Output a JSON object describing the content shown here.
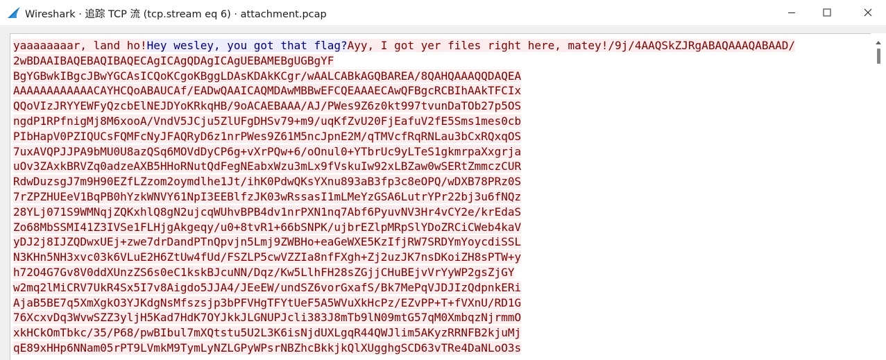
{
  "window": {
    "title": "Wireshark · 追踪 TCP 流 (tcp.stream eq 6) · attachment.pcap",
    "icon": "wireshark-fin-icon",
    "controls": [
      "minimize-icon",
      "maximize-icon",
      "close-icon"
    ]
  },
  "colors": {
    "client_bg": "#fbeded",
    "client_fg": "#7f0000",
    "server_bg": "#ededfb",
    "server_fg": "#00007f"
  },
  "stream": {
    "lines": [
      [
        {
          "dir": "client",
          "text": "yaaaaaaaar, land ho!"
        },
        {
          "dir": "server",
          "text": "Hey wesley, you got that flag?"
        },
        {
          "dir": "client",
          "text": "Ayy, I got yer files right here, matey!/9j/4AAQSkZJRgABAQAAAQABAAD/"
        }
      ],
      [
        {
          "dir": "client",
          "text": "2wBDAAIBAQEBAQIBAQECAgICAgQDAgICAgUEBAMEBgUGBgYF"
        }
      ],
      [
        {
          "dir": "client",
          "text": "BgYGBwkIBgcJBwYGCAsICQoKCgoKBggLDAsKDAkKCgr/wAALCABkAGQBAREA/8QAHQAAAQQDAQEA"
        }
      ],
      [
        {
          "dir": "client",
          "text": "AAAAAAAAAAAACAYHCQoABAUCAf/EADwQAAICAQMDAwMBBwEFCQEAAAECAwQFBgcRCBIhAAkTFCIx"
        }
      ],
      [
        {
          "dir": "client",
          "text": "QQoVIzJRYYEWFyQzcbElNEJDYoKRkqHB/9oACAEBAAA/AJ/PWes9Z6z0kt997tvunDaTOb27p5OS"
        }
      ],
      [
        {
          "dir": "client",
          "text": "ngdP1RPfnigMj8M6xooA/VndV5JCju5ZlUFgDHSv79+m9/uqKfZvU20FjEafuV2fE5Sms1mes0cb"
        }
      ],
      [
        {
          "dir": "client",
          "text": "PIbHapV0PZIQUCsFQMFcNyJFAQRyD6z1nrPWes9Z61M5ncJpnE2M/qTMVcfRqRNLau3bCxRQxqOS"
        }
      ],
      [
        {
          "dir": "client",
          "text": "7uxAVQPJJPA9bMU0U8azQSq6MOVdDyCP6g+vXrPQw+6/oOnul0+YTbrUc9yLTeS1gkmrpaXxgrja"
        }
      ],
      [
        {
          "dir": "client",
          "text": "uOv3ZAxkBRVZq0adzeAXB5HHoRNutQdFegNEabxWzu3mLx9fVskuIw92xLBZaw0wSERtZmmczCUR"
        }
      ],
      [
        {
          "dir": "client",
          "text": "RdwDuzsgJ7m9H90EZfLZzom2oymdlhe1Jt/ihK0PdwQKsYXnu893aB3fp3c8eOPQ/wDXB78PRz0S"
        }
      ],
      [
        {
          "dir": "client",
          "text": "7rZPZHUEeV1BqPB0hYzkWNVY61NpI3EEBlfzJK03wRssasI1mLMeYzGSA6LutrYPr22bj3u6fNQz"
        }
      ],
      [
        {
          "dir": "client",
          "text": "28YLj071S9WMNqjZQKxhlQ8gN2ujcqWUhvBPB4dv1nrPXN1nq7Abf6PyuvNV3Hr4vCY2e/krEdaS"
        }
      ],
      [
        {
          "dir": "client",
          "text": "Zo68MbSSMI41Z3IVSe1FLHjgAkgeqy/u0+8tvR1+66bSNPK/ujbrEZlpMRpSlYDoZRCiCWeb4kaV"
        }
      ],
      [
        {
          "dir": "client",
          "text": "yDJ2j8IJZQDwxUEj+zwe7drDandPTnQpvjn5Lmj9ZWBHo+eaGeWXE5KzIfjRW7SRDYmYoycdiSSL"
        }
      ],
      [
        {
          "dir": "client",
          "text": "N3KHn5NH3xvc03k6VLuE2H6ZtUw4fUd/FSZLP5cwVZZIa8nfFXgh+Zj2uzJK7nsDKoiZH8sPTW+y"
        }
      ],
      [
        {
          "dir": "client",
          "text": "h72O4G7Gv8V0ddXUnzZS6s0eC1kskBJcuNN/Dqz/Kw5LlhFH28sZGjjCHuBEjvVrYyWP2gsZjGY"
        }
      ],
      [
        {
          "dir": "client",
          "text": "w2mq2lMiCRV7UkR4Sx5I7v8Aigdo5JJA4/JEeEW/undSZ6vorGxafS/Bk7MePqVJDJIzQdpnkERi"
        }
      ],
      [
        {
          "dir": "client",
          "text": "AjaB5BE7q5XmXgkO3YJKdgNsMfszsjp3bPFVHgTFYtUeF5A5WVuXkHcPz/EZvPP+T+fVXnU/RD1G"
        }
      ],
      [
        {
          "dir": "client",
          "text": "76XcxvDq3WvwSZZ3yljH5Kad7HdK7OYJkkJLGNUPJcli383J8mTb9lN09mtG57qM0XmbqzNjrmmO"
        }
      ],
      [
        {
          "dir": "client",
          "text": "xkHCkOmTbkc/35/P68/pwBIbul7mXQtstu5U2L3K6isNjdUXLgqR44QWJlim5AKyzRRNFB2kjuMj"
        }
      ],
      [
        {
          "dir": "client",
          "text": "qE89xHHp6NNam05rPT9LVmkM9TymLyNZLGPyWPsrNBZhcBkkjkQlXUgghgSCD63vTRe4DaNLoO3s"
        }
      ]
    ]
  }
}
